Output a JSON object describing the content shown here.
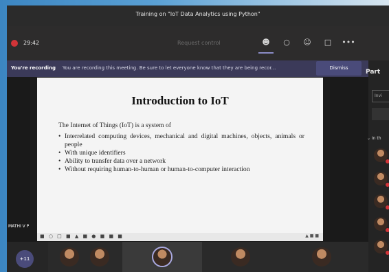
{
  "window": {
    "title": "Training on \"IoT Data Analytics using Python\""
  },
  "toolbar": {
    "timer": "29:42",
    "request_control": "Request control",
    "icons": [
      "participants-icon",
      "chat-icon",
      "reactions-icon",
      "breakout-icon",
      "more-icon"
    ]
  },
  "banner": {
    "heading": "You're recording",
    "message": "You are recording this meeting. Be sure to let everyone know that they are being recor...",
    "dismiss_label": "Dismiss"
  },
  "slide": {
    "title": "Introduction to IoT",
    "lead": "The Internet of Things (IoT) is a system of",
    "bullets": [
      "Interrelated computing devices, mechanical and digital machines, objects, animals or people",
      "With unique identifiers",
      "Ability to transfer data over a network",
      "Without requiring human-to-human or human-to-computer interaction"
    ]
  },
  "presenter": {
    "label": "MATHI V P"
  },
  "gallery": {
    "overflow_count": "+11"
  },
  "side_panel": {
    "title": "Part",
    "search_value": "Invi",
    "section_label": "In th"
  },
  "colors": {
    "accent": "#4a4b7a",
    "recording": "#d13438",
    "banner_bg": "#3b3a59"
  }
}
